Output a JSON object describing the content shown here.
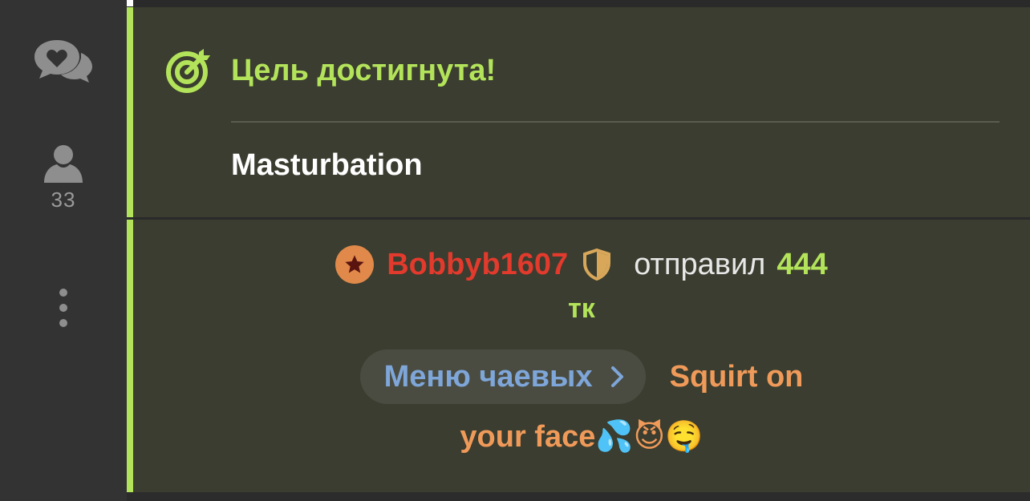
{
  "sidebar": {
    "chat_icon": "chat-heart-icon",
    "user_icon": "user-icon",
    "user_count": "33",
    "more_icon": "more-vertical-icon"
  },
  "goal": {
    "icon": "target-icon",
    "title": "Цель достигнута!",
    "name": "Masturbation"
  },
  "tip": {
    "badge_icon": "star-badge-icon",
    "username": "Bobbyb1607",
    "shield_icon": "shield-icon",
    "sent_text": "отправил",
    "amount": "444",
    "unit": "тк",
    "menu_label": "Меню чаевых",
    "menu_chevron_icon": "chevron-right-icon",
    "message_part1": "Squirt on",
    "message_part2": "your face💦😈🤤"
  },
  "colors": {
    "accent": "#b3e35a",
    "username": "#e23a2d",
    "menu_link": "#7ea6d9",
    "message": "#f09a5a",
    "card_bg": "#3a3d2f"
  }
}
